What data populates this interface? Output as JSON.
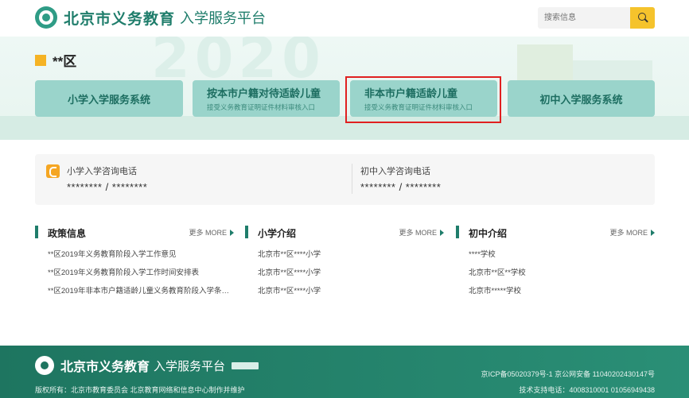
{
  "header": {
    "logo_title": "北京市义务教育",
    "logo_subtitle": "入学服务平台",
    "search_placeholder": "搜索信息"
  },
  "banner": {
    "region": "**区",
    "cards": [
      {
        "title": "小学入学服务系统",
        "sub": ""
      },
      {
        "title": "按本市户籍对待适龄儿童",
        "sub": "接受义务教育证明证件材料审核入口"
      },
      {
        "title": "非本市户籍适龄儿童",
        "sub": "接受义务教育证明证件材料审核入口"
      },
      {
        "title": "初中入学服务系统",
        "sub": ""
      }
    ]
  },
  "phone": {
    "primary_label": "小学入学咨询电话",
    "primary_number": "******** / ********",
    "middle_label": "初中入学咨询电话",
    "middle_number": "******** / ********"
  },
  "columns": [
    {
      "title": "政策信息",
      "more": "更多 MORE",
      "items": [
        "**区2019年义务教育阶段入学工作意见",
        "**区2019年义务教育阶段入学工作时间安排表",
        "**区2019年非本市户籍适龄儿童义务教育阶段入学条件..."
      ]
    },
    {
      "title": "小学介绍",
      "more": "更多 MORE",
      "items": [
        "北京市**区****小学",
        "北京市**区****小学",
        "北京市**区****小学"
      ]
    },
    {
      "title": "初中介绍",
      "more": "更多 MORE",
      "items": [
        "****学校",
        "北京市**区**学校",
        "北京市*****学校"
      ]
    }
  ],
  "footer": {
    "title": "北京市义务教育",
    "subtitle": "入学服务平台",
    "copyright": "版权所有：北京市教育委员会 北京教育网络和信息中心制作并维护",
    "icp": "京ICP备05020379号-1 京公网安备 11040202430147号",
    "tel": "技术支持电话：4008310001 01056949438"
  },
  "colors": {
    "brand_green": "#1f7d6b",
    "card_bg": "#9ad4cb",
    "highlight_red": "#e02020",
    "search_yellow": "#f5c32c"
  }
}
